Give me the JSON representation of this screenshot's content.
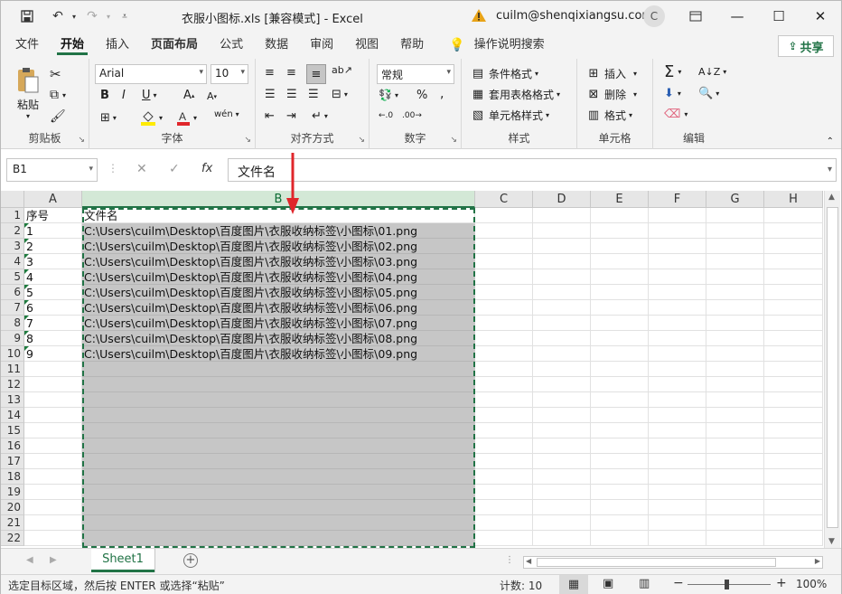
{
  "titlebar": {
    "title": "衣服小图标.xls  [兼容模式]  -  Excel",
    "user": "cuilm@shenqixiangsu.com",
    "avatar_letter": "C"
  },
  "tabs": [
    "文件",
    "开始",
    "插入",
    "页面布局",
    "公式",
    "数据",
    "审阅",
    "视图",
    "帮助"
  ],
  "search_hint": "操作说明搜索",
  "share_label": "共享",
  "ribbon": {
    "paste_label": "粘贴",
    "clipboard_group": "剪贴板",
    "font_name": "Arial",
    "font_size": "10",
    "bold": "B",
    "italic": "I",
    "underline": "U",
    "font_group": "字体",
    "align_group": "对齐方式",
    "number_format": "常规",
    "percent": "%",
    "number_group": "数字",
    "conditional_format": "条件格式",
    "table_format": "套用表格格式",
    "cell_style": "单元格样式",
    "styles_group": "样式",
    "insert": "插入",
    "delete": "删除",
    "format": "格式",
    "cells_group": "单元格",
    "editing_group": "编辑"
  },
  "formula_bar": {
    "name_box": "B1",
    "fx": "fx",
    "content": "文件名"
  },
  "columns": [
    "A",
    "B",
    "C",
    "D",
    "E",
    "F",
    "G",
    "H"
  ],
  "rows": [
    "1",
    "2",
    "3",
    "4",
    "5",
    "6",
    "7",
    "8",
    "9",
    "10",
    "11",
    "12",
    "13",
    "14",
    "15",
    "16",
    "17",
    "18",
    "19",
    "20",
    "21",
    "22"
  ],
  "cells": {
    "A": [
      "序号",
      "1",
      "2",
      "3",
      "4",
      "5",
      "6",
      "7",
      "8",
      "9"
    ],
    "B": [
      "文件名",
      "C:\\Users\\cuilm\\Desktop\\百度图片\\衣服收纳标签\\小图标\\01.png",
      "C:\\Users\\cuilm\\Desktop\\百度图片\\衣服收纳标签\\小图标\\02.png",
      "C:\\Users\\cuilm\\Desktop\\百度图片\\衣服收纳标签\\小图标\\03.png",
      "C:\\Users\\cuilm\\Desktop\\百度图片\\衣服收纳标签\\小图标\\04.png",
      "C:\\Users\\cuilm\\Desktop\\百度图片\\衣服收纳标签\\小图标\\05.png",
      "C:\\Users\\cuilm\\Desktop\\百度图片\\衣服收纳标签\\小图标\\06.png",
      "C:\\Users\\cuilm\\Desktop\\百度图片\\衣服收纳标签\\小图标\\07.png",
      "C:\\Users\\cuilm\\Desktop\\百度图片\\衣服收纳标签\\小图标\\08.png",
      "C:\\Users\\cuilm\\Desktop\\百度图片\\衣服收纳标签\\小图标\\09.png"
    ]
  },
  "sheet_tab": "Sheet1",
  "status": {
    "message": "选定目标区域，然后按 ENTER 或选择“粘贴”",
    "count": "计数: 10",
    "zoom": "100%"
  },
  "colors": {
    "accent": "#217346",
    "selection": "#c6c6c6",
    "arrow": "#e0262b"
  }
}
